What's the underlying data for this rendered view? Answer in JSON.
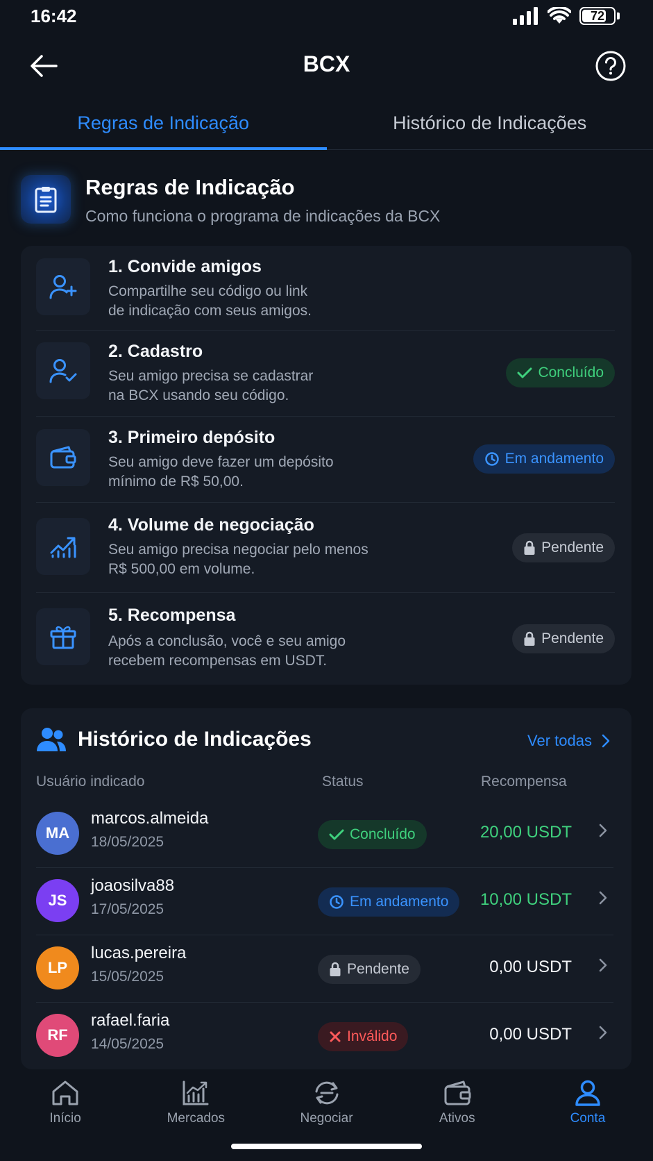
{
  "status_bar": {
    "time": "16:42",
    "battery": "72"
  },
  "header": {
    "title": "BCX"
  },
  "tabs": [
    {
      "label": "Regras de Indicação",
      "active": true
    },
    {
      "label": "Histórico de Indicações",
      "active": false
    }
  ],
  "rules": {
    "title": "Regras de Indicação",
    "subtitle": "Como funciona o programa de indicações da BCX",
    "steps": [
      {
        "title": "1. Convide amigos",
        "desc1": "Compartilhe seu código ou link",
        "desc2": "de indicação com seus amigos.",
        "icon": "user-plus-icon",
        "status": ""
      },
      {
        "title": "2. Cadastro",
        "desc1": "Seu amigo precisa se cadastrar",
        "desc2": "na BCX usando seu código.",
        "icon": "user-check-icon",
        "status": "Concluído"
      },
      {
        "title": "3. Primeiro depósito",
        "desc1": "Seu amigo deve fazer um depósito",
        "desc2": "mínimo de R$ 50,00.",
        "icon": "wallet-icon",
        "status": "Em andamento"
      },
      {
        "title": "4. Volume de negociação",
        "desc1": "Seu amigo precisa negociar pelo menos",
        "desc2": "R$ 500,00 em volume.",
        "icon": "chart-up-icon",
        "status": "Pendente"
      },
      {
        "title": "5. Recompensa",
        "desc1": "Após a conclusão, você e seu amigo",
        "desc2": "recebem recompensas em USDT.",
        "icon": "gift-icon",
        "status": "Pendente"
      }
    ]
  },
  "history": {
    "title": "Histórico de Indicações",
    "see_all": "Ver todas",
    "columns": {
      "user": "Usuário indicado",
      "status": "Status",
      "reward": "Recompensa"
    },
    "rows": [
      {
        "initials": "MA",
        "name": "marcos.almeida",
        "date": "18/05/2025",
        "status": "Concluído",
        "reward": "20,00 USDT",
        "color": "#4a6fd1"
      },
      {
        "initials": "JS",
        "name": "joaosilva88",
        "date": "17/05/2025",
        "status": "Em andamento",
        "reward": "10,00 USDT",
        "color": "#7b3ff2"
      },
      {
        "initials": "LP",
        "name": "lucas.pereira",
        "date": "15/05/2025",
        "status": "Pendente",
        "reward": "0,00 USDT",
        "color": "#f08a1d"
      },
      {
        "initials": "RF",
        "name": "rafael.faria",
        "date": "14/05/2025",
        "status": "Inválido",
        "reward": "0,00 USDT",
        "color": "#e04a78"
      }
    ]
  },
  "nav": [
    {
      "label": "Início",
      "icon": "home-icon"
    },
    {
      "label": "Mercados",
      "icon": "markets-icon"
    },
    {
      "label": "Negociar",
      "icon": "trade-icon"
    },
    {
      "label": "Ativos",
      "icon": "wallet-icon"
    },
    {
      "label": "Conta",
      "icon": "account-icon",
      "active": true
    }
  ]
}
